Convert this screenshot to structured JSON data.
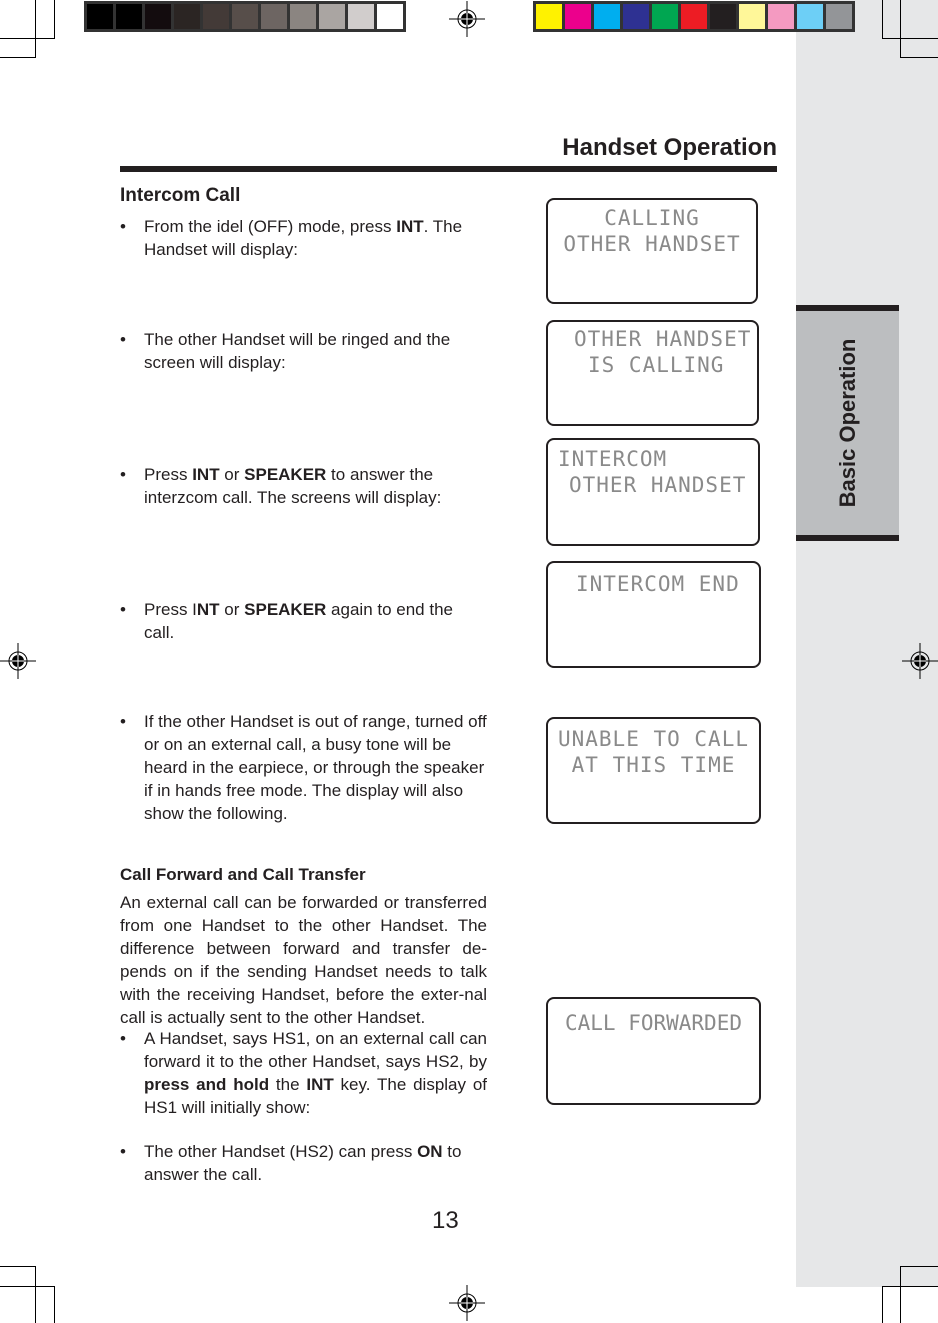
{
  "print_marks": {
    "gray_swatches": [
      "#000000",
      "#000000",
      "#130c0e",
      "#2b2523",
      "#433a37",
      "#574e4a",
      "#6d6562",
      "#8b8581",
      "#aaa5a2",
      "#d1cdcc",
      "#ffffff"
    ],
    "color_swatches": [
      "#fff200",
      "#ec008c",
      "#00aeef",
      "#2e3192",
      "#00a651",
      "#ed1c24",
      "#231f20",
      "#fff799",
      "#f49ac1",
      "#6dcff6",
      "#939598"
    ]
  },
  "header": {
    "title": "Handset Operation"
  },
  "side_tab": {
    "label": "Basic Operation"
  },
  "intercom": {
    "heading": "Intercom Call",
    "bullets": [
      {
        "parts": [
          [
            "From the idel (OFF) mode,  press ",
            false
          ],
          [
            "INT",
            true
          ],
          [
            ".  The Handset will display:",
            false
          ]
        ]
      },
      {
        "parts": [
          [
            "The other Handset will be ringed and the screen will display:",
            false
          ]
        ]
      },
      {
        "parts": [
          [
            "Press ",
            false
          ],
          [
            "INT",
            true
          ],
          [
            " or ",
            false
          ],
          [
            "SPEAKER",
            true
          ],
          [
            " to answer the interzcom call. The screens will display:",
            false
          ]
        ]
      },
      {
        "parts": [
          [
            "Press I",
            false
          ],
          [
            "NT",
            true
          ],
          [
            " or ",
            false
          ],
          [
            "SPEAKER",
            true
          ],
          [
            " again to end the call.",
            false
          ]
        ]
      },
      {
        "parts": [
          [
            "If the other Handset is out of range, turned off or on an external call, a busy tone will be heard in the earpiece, or through the speaker if in hands free mode. The display will also show the following.",
            false
          ]
        ]
      }
    ]
  },
  "forward": {
    "heading": "Call Forward and Call Transfer",
    "paragraph": "An external call can be forwarded or transferred from one Handset to the other Handset. The difference between forward and transfer de-pends on if the sending Handset needs to talk with the receiving Handset, before the exter-nal call is actually sent to the other Handset.",
    "bullets": [
      {
        "parts": [
          [
            " A Handset, says HS1, on an external call can forward it to the other Handset, says HS2, by ",
            false
          ],
          [
            "press and hold",
            true
          ],
          [
            " the ",
            false
          ],
          [
            "INT",
            true
          ],
          [
            " key.  The display of HS1 will initially show:",
            false
          ]
        ]
      },
      {
        "parts": [
          [
            "The other Handset (HS2) can press ",
            false
          ],
          [
            "ON",
            true
          ],
          [
            " to answer the call.",
            false
          ]
        ]
      }
    ]
  },
  "screens": [
    {
      "lines": [
        "CALLING",
        "OTHER HANDSET"
      ]
    },
    {
      "lines": [
        "OTHER HANDSET",
        "IS CALLING"
      ]
    },
    {
      "lines": [
        "INTERCOM",
        "OTHER HANDSET"
      ]
    },
    {
      "lines": [
        "INTERCOM END"
      ]
    },
    {
      "lines": [
        "UNABLE TO CALL",
        "AT THIS TIME"
      ]
    },
    {
      "lines": [
        "CALL FORWARDED"
      ]
    }
  ],
  "page_number": "13"
}
